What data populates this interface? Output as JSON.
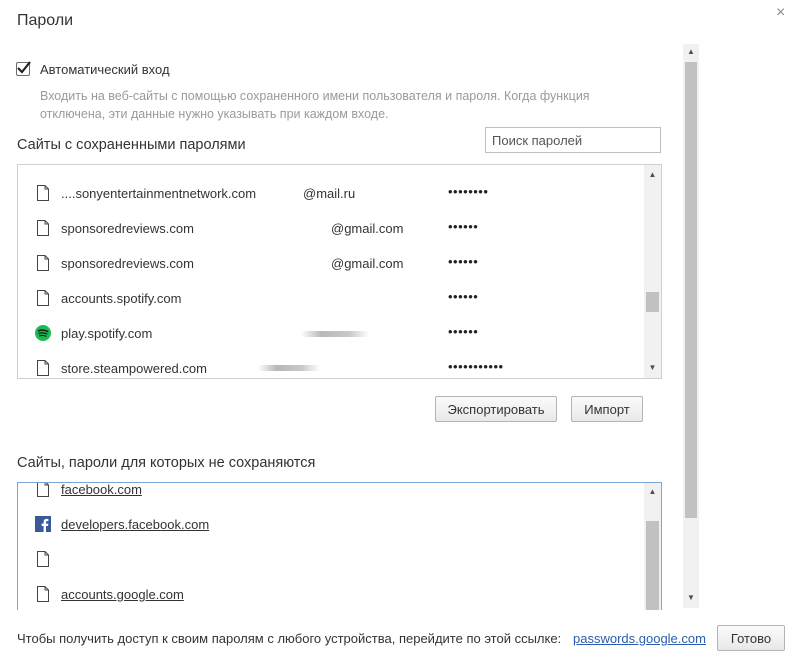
{
  "dialog": {
    "title": "Пароли",
    "close_glyph": "×"
  },
  "autologin": {
    "checked": true,
    "label": "Автоматический вход",
    "description_line1": "Входить на веб-сайты с помощью сохраненного имени пользователя и пароля. Когда функция",
    "description_line2": "отключена, эти данные нужно указывать при каждом входе."
  },
  "saved": {
    "heading": "Сайты с сохраненными паролями",
    "search_placeholder": "Поиск паролей",
    "rows": [
      {
        "icon": "page-icon",
        "site": "....sonyentertainmentnetwork.com",
        "user": "@mail.ru",
        "password": "••••••••"
      },
      {
        "icon": "page-icon",
        "site": "sponsoredreviews.com",
        "user": "@gmail.com",
        "password": "••••••"
      },
      {
        "icon": "page-icon",
        "site": "sponsoredreviews.com",
        "user": "@gmail.com",
        "password": "••••••"
      },
      {
        "icon": "page-icon",
        "site": "accounts.spotify.com",
        "user": "",
        "password": "••••••"
      },
      {
        "icon": "spotify-icon",
        "site": "play.spotify.com",
        "user": "",
        "password": "••••••"
      },
      {
        "icon": "page-icon",
        "site": "store.steampowered.com",
        "user": "",
        "password": "•••••••••••"
      }
    ],
    "export_label": "Экспортировать",
    "import_label": "Импорт"
  },
  "never_saved": {
    "heading": "Сайты, пароли для которых не сохраняются",
    "rows": [
      {
        "icon": "page-icon",
        "site": "facebook.com"
      },
      {
        "icon": "facebook-icon",
        "site": "developers.facebook.com"
      },
      {
        "icon": "page-icon",
        "site": ""
      },
      {
        "icon": "page-icon",
        "site": "accounts.google.com"
      }
    ]
  },
  "footer": {
    "text": "Чтобы получить доступ к своим паролям с любого устройства, перейдите по этой ссылке:",
    "link": "passwords.google.com",
    "done_label": "Готово"
  },
  "colors": {
    "link": "#2a5db0",
    "spotify": "#1db954",
    "facebook": "#3b5998",
    "focus_border": "#7aa7d9"
  }
}
